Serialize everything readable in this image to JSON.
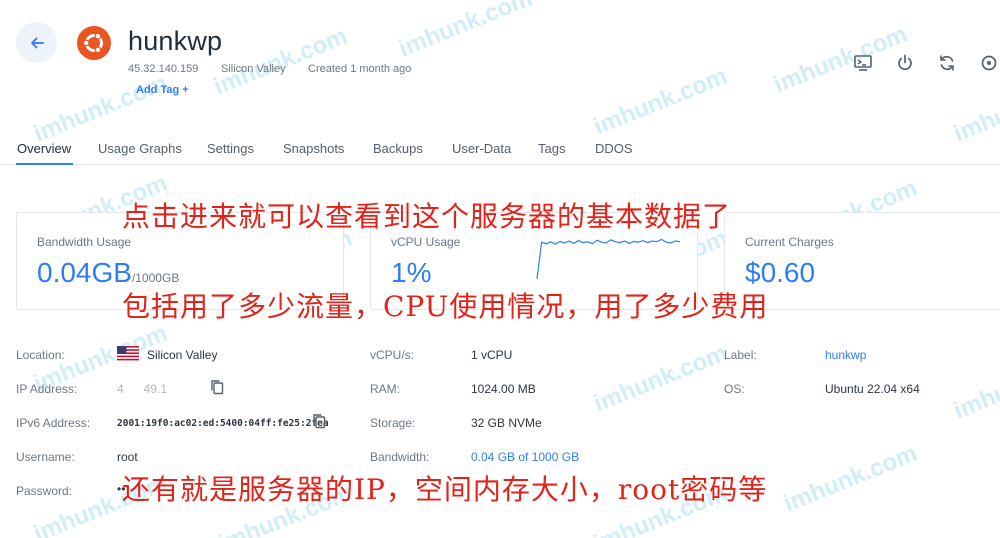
{
  "header": {
    "server_name": "hunkwp",
    "ip": "45.32.140.159",
    "location": "Silicon Valley",
    "created": "Created 1 month ago",
    "add_tag": "Add Tag +"
  },
  "tabs": [
    "Overview",
    "Usage Graphs",
    "Settings",
    "Snapshots",
    "Backups",
    "User-Data",
    "Tags",
    "DDOS"
  ],
  "cards": {
    "bandwidth": {
      "label": "Bandwidth Usage",
      "value": "0.04GB",
      "sub": "/1000GB"
    },
    "cpu": {
      "label": "vCPU Usage",
      "value": "1%",
      "sparkline": [
        0.0,
        0.92,
        0.88,
        0.93,
        0.87,
        0.94,
        0.9,
        0.95,
        0.89,
        0.96,
        0.91,
        0.93,
        0.88,
        0.97,
        0.92,
        0.9,
        0.98,
        0.93,
        0.91,
        0.95,
        0.89,
        0.94,
        0.92,
        0.96,
        0.91,
        0.95,
        0.93,
        0.99,
        0.92,
        0.9,
        0.95,
        0.93
      ]
    },
    "charges": {
      "label": "Current Charges",
      "value": "$0.60"
    }
  },
  "details": {
    "location_label": "Location:",
    "location_value": "Silicon Valley",
    "ip_label": "IP Address:",
    "ip_value": "4      49.1",
    "ipv6_label": "IPv6 Address:",
    "ipv6_value": "2001:19f0:ac02:ed:5400:04ff:fe25:2fea",
    "username_label": "Username:",
    "username_value": "root",
    "password_label": "Password:",
    "password_value": "••",
    "vcpu_label": "vCPU/s:",
    "vcpu_value": "1 vCPU",
    "ram_label": "RAM:",
    "ram_value": "1024.00 MB",
    "storage_label": "Storage:",
    "storage_value": "32 GB NVMe",
    "bandwidth_label": "Bandwidth:",
    "bandwidth_value": "0.04 GB of 1000 GB",
    "label_label": "Label:",
    "label_value": "hunkwp",
    "os_label": "OS:",
    "os_value": "Ubuntu 22.04 x64"
  },
  "annotations": {
    "line1": "点击进来就可以查看到这个服务器的基本数据了",
    "line2": "包括用了多少流量，CPU使用情况，用了多少费用",
    "line3": "还有就是服务器的IP，空间内存大小，root密码等"
  },
  "watermark": "imhunk.com",
  "colors": {
    "accent": "#2f7df6",
    "annotation": "#e0241a",
    "ubuntu": "#e95420"
  }
}
